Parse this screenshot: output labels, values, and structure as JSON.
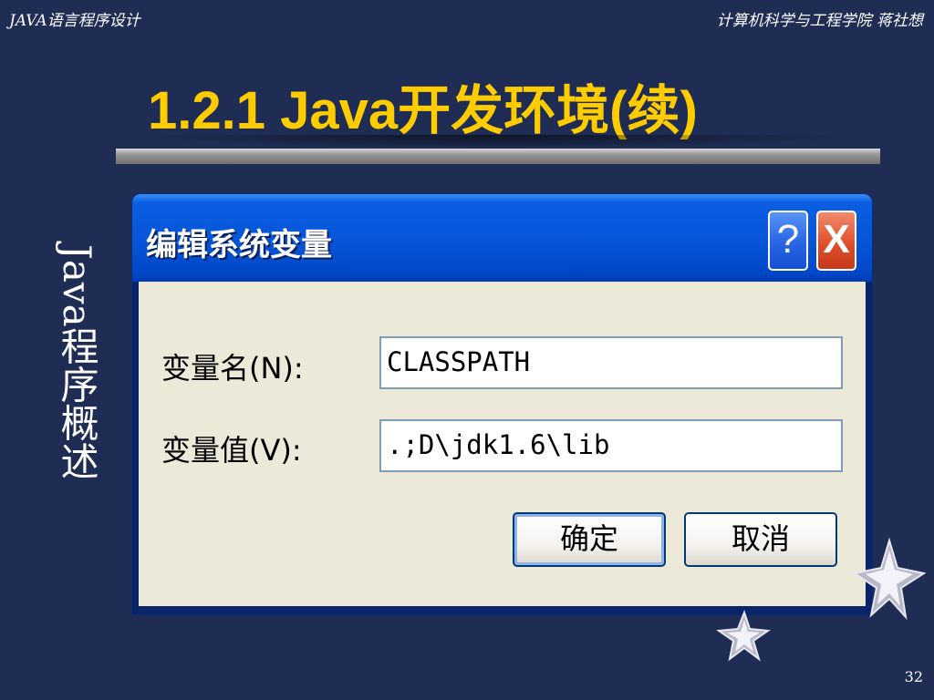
{
  "header": {
    "left": "JAVA语言程序设计",
    "right": "计算机科学与工程学院  蒋社想"
  },
  "slide": {
    "title": "1.2.1 Java开发环境(续)",
    "side_text": "Java程序概述",
    "page_number": "32"
  },
  "dialog": {
    "title": "编辑系统变量",
    "help_label": "?",
    "close_label": "X",
    "fields": [
      {
        "label": "变量名(N):",
        "value": "CLASSPATH"
      },
      {
        "label": "变量值(V):",
        "value": ".;D\\jdk1.6\\lib"
      }
    ],
    "ok_label": "确定",
    "cancel_label": "取消"
  },
  "decorations": {
    "icons": [
      "star-icon",
      "star-icon"
    ]
  }
}
